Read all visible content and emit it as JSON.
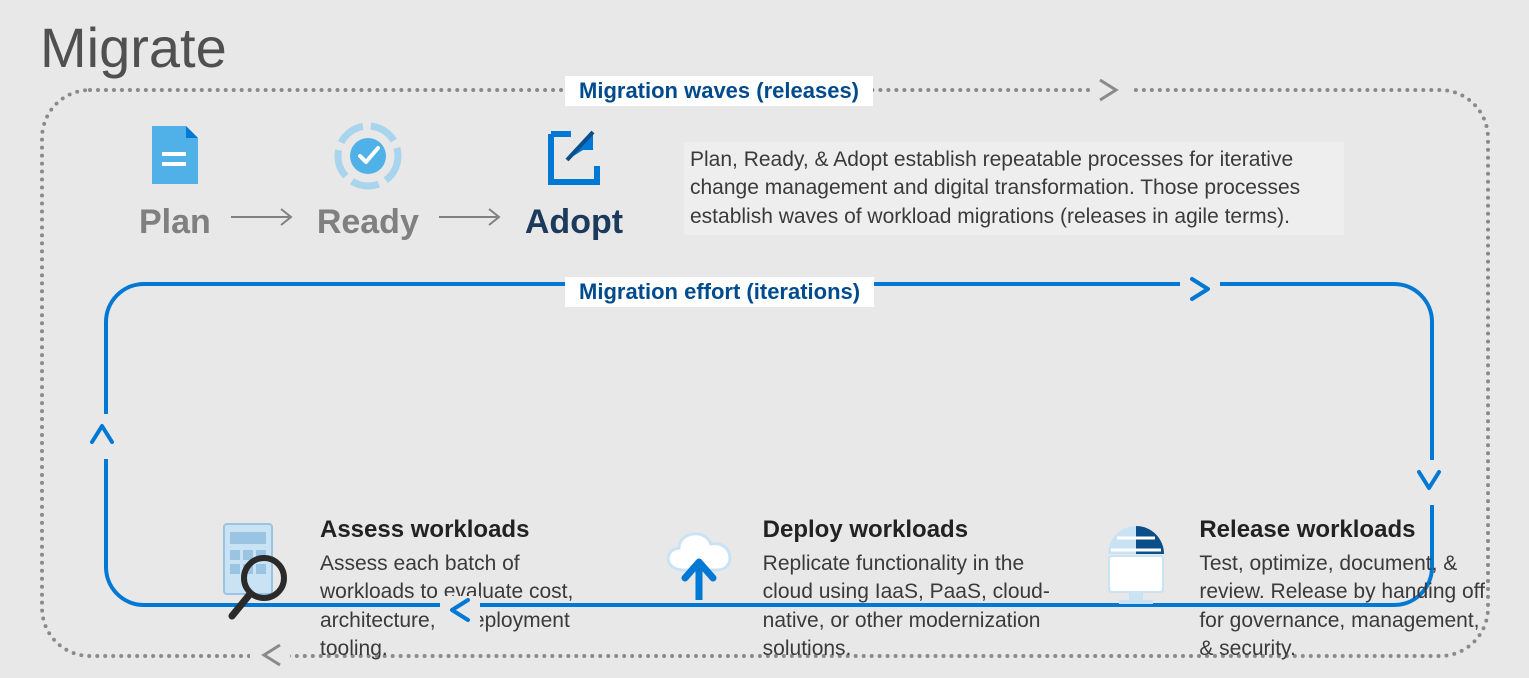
{
  "title": "Migrate",
  "outer_label": "Migration waves (releases)",
  "inner_label": "Migration effort (iterations)",
  "steps": {
    "plan": "Plan",
    "ready": "Ready",
    "adopt": "Adopt"
  },
  "description": "Plan, Ready, & Adopt establish repeatable processes for iterative change management and digital transformation. Those processes establish waves of workload migrations (releases in agile terms).",
  "workloads": {
    "assess": {
      "title": "Assess workloads",
      "desc": "Assess each batch of workloads to evaluate cost, architecture, & deployment tooling."
    },
    "deploy": {
      "title": "Deploy workloads",
      "desc": "Replicate functionality in the cloud using IaaS, PaaS, cloud-native, or other modernization solutions."
    },
    "release": {
      "title": "Release workloads",
      "desc": "Test, optimize, document, & review. Release by handing off for governance, management, & security."
    }
  },
  "colors": {
    "azure_blue": "#0078d4",
    "azure_light": "#50b0e8",
    "dark_navy": "#1b3a5c",
    "grey": "#808080"
  }
}
